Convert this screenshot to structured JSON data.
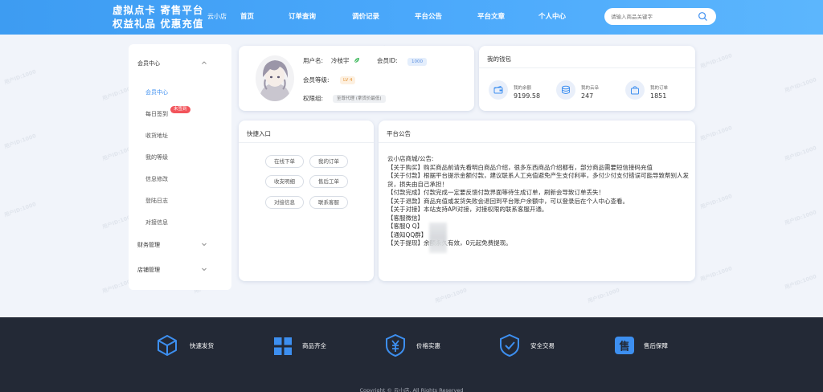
{
  "header": {
    "logo_line1": "虚拟点卡 寄售平台",
    "logo_line2": "权益礼品 优惠充值",
    "shop_name": "云小店",
    "nav": [
      "首页",
      "订单查询",
      "调价记录",
      "平台公告",
      "平台文章",
      "个人中心"
    ],
    "search_placeholder": "请输入商品关键字"
  },
  "sidebar": {
    "section_member": "会员中心",
    "items": [
      "会员中心",
      "每日签到",
      "收货地址",
      "我的等级",
      "信息修改",
      "登陆日志",
      "对接信息"
    ],
    "badge": "未签到",
    "section_finance": "财务管理",
    "section_shop": "店铺管理"
  },
  "user": {
    "username_label": "用户名:",
    "username": "冷枝宇",
    "member_id_label": "会员ID:",
    "member_id": "1000",
    "level_label": "会员等级:",
    "level": "LV 4",
    "perm_label": "权限组:",
    "perm": "至尊代理 (拿货价最低)"
  },
  "wallet": {
    "title": "我的钱包",
    "items": [
      {
        "label": "我的余额",
        "value": "9199.58"
      },
      {
        "label": "我的云朵",
        "value": "247"
      },
      {
        "label": "我的订单",
        "value": "1851"
      }
    ]
  },
  "quick": {
    "title": "快捷入口",
    "buttons": [
      "在线下单",
      "我的订单",
      "收支明细",
      "售后工单",
      "对接信息",
      "联系客服"
    ]
  },
  "notice": {
    "title": "平台公告",
    "lines": [
      "云小店商城/公告:",
      "【关于购买】购买商品前请先看明白商品介绍，很多东西商品介绍都有，部分商品需要短信接码充值",
      "【关于付款】根据平台提示金额付款，建议联系人工充值避免产生支付利率，多付少付支付错误可能导致帮别人发货，损失由自己承担！",
      "【付款完成】付款完成一定要反馈付款界面等待生成订单，刷新会导致订单丢失！",
      "【关于退款】商品充值或发货失败会退回到平台账户余额中，可以登录后在个人中心查看。",
      "【关于对接】本站支持API对接，对接权限的联系客服开通。",
      "【客服微信】",
      "【客服Q Q】",
      "【通知QQ群】",
      "【关于提现】余额永久有效，0元起免费提现。"
    ]
  },
  "footer": {
    "features": [
      "快速发货",
      "商品齐全",
      "价格实惠",
      "安全交易",
      "售后保障"
    ],
    "copyright": "Copyright © 云小店. All Rights Reserved"
  },
  "watermark": "用户ID:1000",
  "colors": {
    "primary": "#3d9cf2",
    "footer_bg": "#232936",
    "icon_blue": "#3d8ff0",
    "badge_red": "#f2545b"
  }
}
